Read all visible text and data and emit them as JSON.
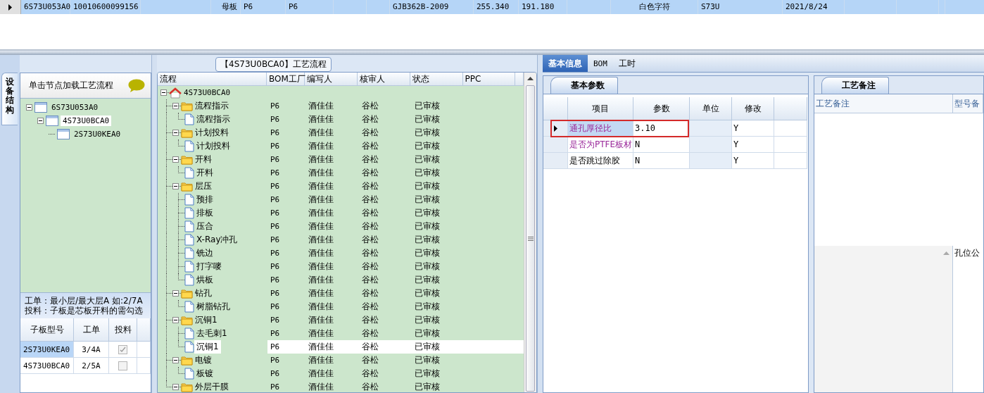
{
  "top_grid": {
    "rows": [
      {
        "selected": true,
        "cells": [
          "6S73U053A0",
          "10010600099156",
          "",
          "母板",
          "P6",
          "P6",
          "",
          "",
          "GJB362B-2009",
          "255.340",
          "191.180",
          "",
          "白色字符",
          "S73U",
          "2021/8/24",
          "",
          "",
          ""
        ]
      }
    ]
  },
  "side_tab": {
    "label": "设备结构"
  },
  "structure_panel": {
    "hint": "单击节点加载工艺流程",
    "tree": [
      {
        "label": "6S73U053A0",
        "expanded": true,
        "selected": false,
        "children": [
          {
            "label": "4S73U0BCA0",
            "expanded": true,
            "selected": true,
            "children": [
              {
                "label": "2S73U0KEA0",
                "selected": false
              }
            ]
          }
        ]
      }
    ],
    "note_lines": [
      "工单：最小层/最大层A 如:2/7A",
      "投料：子板是芯板开料的需勾选"
    ],
    "sub_boards": {
      "columns": [
        "子板型号",
        "工单",
        "投料"
      ],
      "rows": [
        {
          "model": "2S73U0KEA0",
          "order": "3/4A",
          "checked": true,
          "selected": true
        },
        {
          "model": "4S73U0BCA0",
          "order": "2/5A",
          "checked": false,
          "selected": false
        }
      ]
    }
  },
  "process_panel": {
    "title": "【4S73U0BCA0】工艺流程",
    "columns": [
      "流程",
      "BOM工厂",
      "编写人",
      "核审人",
      "状态",
      "PPC"
    ],
    "tree": [
      {
        "kind": "root",
        "label": "4S73U0BCA0",
        "expanded": true,
        "selected": false,
        "children": [
          {
            "kind": "folder",
            "label": "流程指示",
            "expanded": true,
            "selected": false,
            "bom": "P6",
            "writer": "酒佳佳",
            "reviewer": "谷松",
            "status": "已审核",
            "children": [
              {
                "kind": "step",
                "label": "流程指示",
                "selected": false,
                "bom": "P6",
                "writer": "酒佳佳",
                "reviewer": "谷松",
                "status": "已审核"
              }
            ]
          },
          {
            "kind": "folder",
            "label": "计划投料",
            "expanded": true,
            "selected": false,
            "bom": "P6",
            "writer": "酒佳佳",
            "reviewer": "谷松",
            "status": "已审核",
            "children": [
              {
                "kind": "step",
                "label": "计划投料",
                "selected": false,
                "bom": "P6",
                "writer": "酒佳佳",
                "reviewer": "谷松",
                "status": "已审核"
              }
            ]
          },
          {
            "kind": "folder",
            "label": "开料",
            "expanded": true,
            "selected": false,
            "bom": "P6",
            "writer": "酒佳佳",
            "reviewer": "谷松",
            "status": "已审核",
            "children": [
              {
                "kind": "step",
                "label": "开料",
                "selected": false,
                "bom": "P6",
                "writer": "酒佳佳",
                "reviewer": "谷松",
                "status": "已审核"
              }
            ]
          },
          {
            "kind": "folder",
            "label": "层压",
            "expanded": true,
            "selected": false,
            "bom": "P6",
            "writer": "酒佳佳",
            "reviewer": "谷松",
            "status": "已审核",
            "children": [
              {
                "kind": "step",
                "label": "预排",
                "selected": false,
                "bom": "P6",
                "writer": "酒佳佳",
                "reviewer": "谷松",
                "status": "已审核"
              },
              {
                "kind": "step",
                "label": "排板",
                "selected": false,
                "bom": "P6",
                "writer": "酒佳佳",
                "reviewer": "谷松",
                "status": "已审核"
              },
              {
                "kind": "step",
                "label": "压合",
                "selected": false,
                "bom": "P6",
                "writer": "酒佳佳",
                "reviewer": "谷松",
                "status": "已审核"
              },
              {
                "kind": "step",
                "label": "X-Ray冲孔",
                "selected": false,
                "bom": "P6",
                "writer": "酒佳佳",
                "reviewer": "谷松",
                "status": "已审核"
              },
              {
                "kind": "step",
                "label": "铣边",
                "selected": false,
                "bom": "P6",
                "writer": "酒佳佳",
                "reviewer": "谷松",
                "status": "已审核"
              },
              {
                "kind": "step",
                "label": "打字嘜",
                "selected": false,
                "bom": "P6",
                "writer": "酒佳佳",
                "reviewer": "谷松",
                "status": "已审核"
              },
              {
                "kind": "step",
                "label": "烘板",
                "selected": false,
                "bom": "P6",
                "writer": "酒佳佳",
                "reviewer": "谷松",
                "status": "已审核"
              }
            ]
          },
          {
            "kind": "folder",
            "label": "钻孔",
            "expanded": true,
            "selected": false,
            "bom": "P6",
            "writer": "酒佳佳",
            "reviewer": "谷松",
            "status": "已审核",
            "children": [
              {
                "kind": "step",
                "label": "树脂钻孔",
                "selected": false,
                "bom": "P6",
                "writer": "酒佳佳",
                "reviewer": "谷松",
                "status": "已审核"
              }
            ]
          },
          {
            "kind": "folder",
            "label": "沉铜1",
            "expanded": true,
            "selected": false,
            "bom": "P6",
            "writer": "酒佳佳",
            "reviewer": "谷松",
            "status": "已审核",
            "children": [
              {
                "kind": "step",
                "label": "去毛刺1",
                "selected": false,
                "bom": "P6",
                "writer": "酒佳佳",
                "reviewer": "谷松",
                "status": "已审核"
              },
              {
                "kind": "step",
                "label": "沉铜1",
                "selected": true,
                "bom": "P6",
                "writer": "酒佳佳",
                "reviewer": "谷松",
                "status": "已审核"
              }
            ]
          },
          {
            "kind": "folder",
            "label": "电镀",
            "expanded": true,
            "selected": false,
            "bom": "P6",
            "writer": "酒佳佳",
            "reviewer": "谷松",
            "status": "已审核",
            "children": [
              {
                "kind": "step",
                "label": "板镀",
                "selected": false,
                "bom": "P6",
                "writer": "酒佳佳",
                "reviewer": "谷松",
                "status": "已审核"
              }
            ]
          },
          {
            "kind": "folder",
            "label": "外层干膜",
            "expanded": true,
            "selected": false,
            "bom": "P6",
            "writer": "酒佳佳",
            "reviewer": "谷松",
            "status": "已审核"
          }
        ]
      }
    ]
  },
  "detail_tabs": [
    {
      "label": "基本信息",
      "selected": true
    },
    {
      "label": "BOM",
      "selected": false
    },
    {
      "label": "工时",
      "selected": false
    }
  ],
  "params_panel": {
    "tab": "基本参数",
    "columns": [
      "项目",
      "参数",
      "单位",
      "修改"
    ],
    "rows": [
      {
        "item": "通孔厚径比",
        "value": "3.10",
        "unit": "",
        "editable": "Y",
        "kind": "flagged",
        "selected": true
      },
      {
        "item": "是否为PTFE板材",
        "value": "N",
        "unit": "",
        "editable": "Y",
        "kind": "flagged",
        "selected": false
      },
      {
        "item": "是否跳过除胶",
        "value": "N",
        "unit": "",
        "editable": "Y",
        "kind": "plain",
        "selected": false
      }
    ]
  },
  "notes_panel": {
    "tab": "工艺备注",
    "columns": [
      "工艺备注",
      "型号备"
    ],
    "cells": [
      "",
      "孔位公"
    ]
  }
}
